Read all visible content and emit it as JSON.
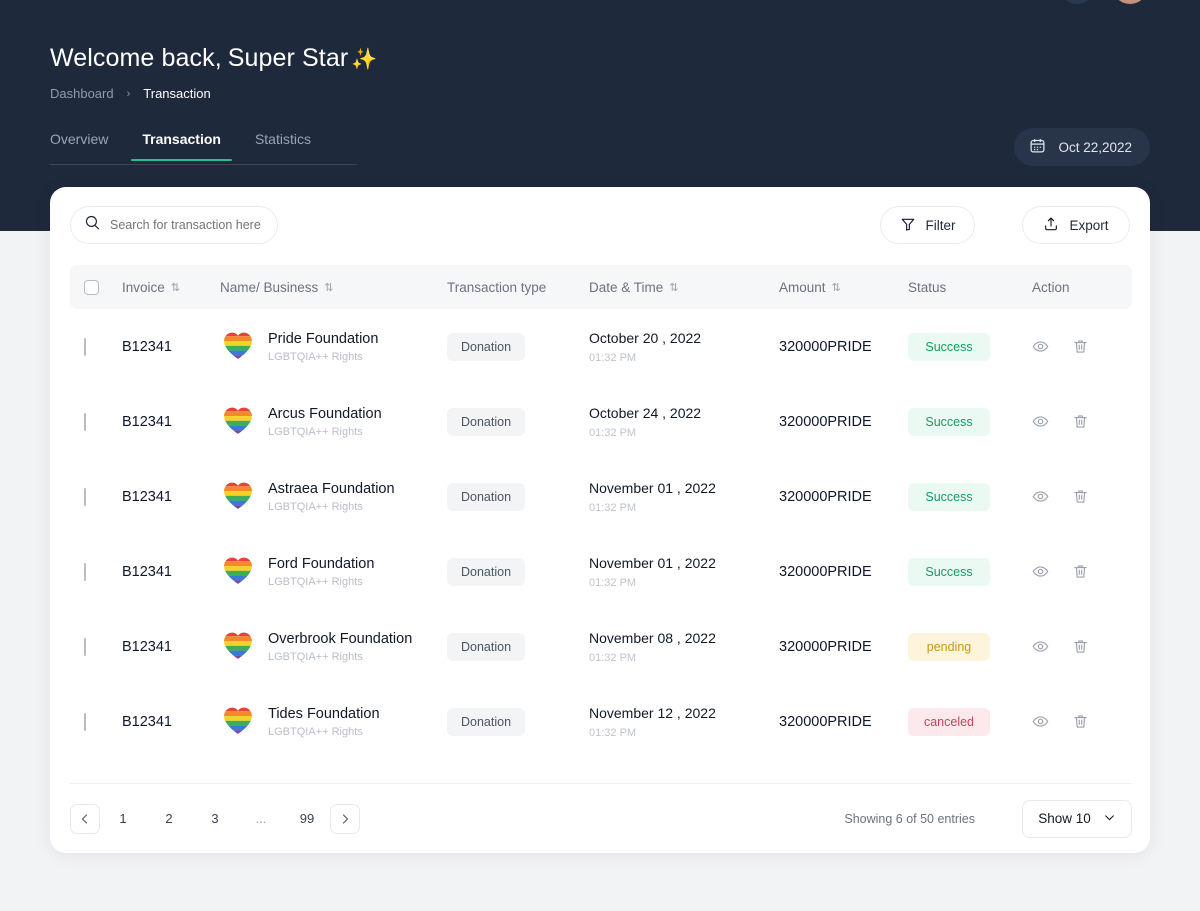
{
  "topnav": {
    "logo_icon": "globe-logo-icon",
    "nav_pill_label": "",
    "search_icon": "search-icon",
    "bell_icon": "bell-icon",
    "avatar_icon": "user-avatar"
  },
  "header": {
    "welcome_prefix": "Welcome back,",
    "user_name": "Super Star",
    "sparkle": "✨",
    "breadcrumb": {
      "root": "Dashboard",
      "separator": "›",
      "current": "Transaction"
    },
    "tabs": [
      {
        "label": "Overview",
        "active": false
      },
      {
        "label": "Transaction",
        "active": true
      },
      {
        "label": "Statistics",
        "active": false
      }
    ],
    "datepicker": {
      "icon": "calendar-icon",
      "label": "Oct 22,2022"
    },
    "accent_color": "#2bbd8a",
    "background_color": "#1e293b"
  },
  "toolbar": {
    "search_placeholder": "Search for transaction here",
    "search_value": "",
    "search_icon": "search-icon",
    "filter_label": "Filter",
    "filter_icon": "funnel-icon",
    "export_label": "Export",
    "export_icon": "upload-icon"
  },
  "table": {
    "select_all_checkbox": "select-all-checkbox",
    "columns": [
      {
        "label": "Invoice",
        "sortable": true
      },
      {
        "label": "Name/ Business",
        "sortable": true
      },
      {
        "label": "Transaction type",
        "sortable": false
      },
      {
        "label": "Date & Time",
        "sortable": true
      },
      {
        "label": "Amount",
        "sortable": true
      },
      {
        "label": "Status",
        "sortable": false
      },
      {
        "label": "Action",
        "sortable": false
      }
    ],
    "sort_icon": "sort-updown-icon",
    "rows": [
      {
        "invoice": "B12341",
        "avatar_icon": "rainbow-heart-icon",
        "name": "Pride Foundation",
        "subtitle": "LGBTQIA++ Rights",
        "type": "Donation",
        "date": "October 20 , 2022",
        "time": "01:32 PM",
        "amount": "320000PRIDE",
        "status": "Success",
        "status_kind": "success"
      },
      {
        "invoice": "B12341",
        "avatar_icon": "rainbow-heart-icon",
        "name": "Arcus Foundation",
        "subtitle": "LGBTQIA++ Rights",
        "type": "Donation",
        "date": "October 24 , 2022",
        "time": "01:32 PM",
        "amount": "320000PRIDE",
        "status": "Success",
        "status_kind": "success"
      },
      {
        "invoice": "B12341",
        "avatar_icon": "rainbow-heart-icon",
        "name": "Astraea  Foundation",
        "subtitle": "LGBTQIA++ Rights",
        "type": "Donation",
        "date": "November 01 , 2022",
        "time": "01:32 PM",
        "amount": "320000PRIDE",
        "status": "Success",
        "status_kind": "success"
      },
      {
        "invoice": "B12341",
        "avatar_icon": "rainbow-heart-icon",
        "name": "Ford Foundation",
        "subtitle": "LGBTQIA++ Rights",
        "type": "Donation",
        "date": "November 01 , 2022",
        "time": "01:32 PM",
        "amount": "320000PRIDE",
        "status": "Success",
        "status_kind": "success"
      },
      {
        "invoice": "B12341",
        "avatar_icon": "rainbow-heart-icon",
        "name": "Overbrook Foundation",
        "subtitle": "LGBTQIA++ Rights",
        "type": "Donation",
        "date": "November 08 , 2022",
        "time": "01:32 PM",
        "amount": "320000PRIDE",
        "status": "pending",
        "status_kind": "pending"
      },
      {
        "invoice": "B12341",
        "avatar_icon": "rainbow-heart-icon",
        "name": "Tides Foundation",
        "subtitle": "LGBTQIA++ Rights",
        "type": "Donation",
        "date": "November 12 , 2022",
        "time": "01:32 PM",
        "amount": "320000PRIDE",
        "status": "canceled",
        "status_kind": "canceled"
      }
    ],
    "row_actions": {
      "view_icon": "eye-icon",
      "delete_icon": "trash-icon"
    },
    "status_colors": {
      "success_text": "#199a65",
      "success_bg": "#eafaf2",
      "pending_text": "#c79a12",
      "pending_bg": "#fdf4db",
      "canceled_text": "#c4455c",
      "canceled_bg": "#fbe9ec"
    }
  },
  "footer": {
    "prev_icon": "chevron-left-icon",
    "next_icon": "chevron-right-icon",
    "pages": [
      "1",
      "2",
      "3",
      "...",
      "99"
    ],
    "showing_text": "Showing 6 of 50 entries",
    "page_size_label": "Show 10",
    "chevron_icon": "chevron-down-icon"
  }
}
